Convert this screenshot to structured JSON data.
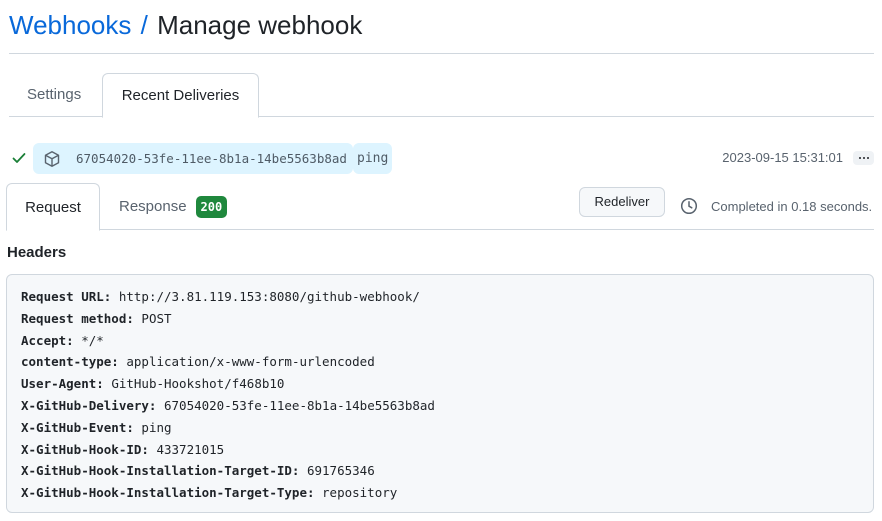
{
  "breadcrumb": {
    "parent": "Webhooks",
    "separator": "/",
    "current": "Manage webhook"
  },
  "tabs": {
    "settings": "Settings",
    "recent_deliveries": "Recent Deliveries"
  },
  "delivery": {
    "status_icon": "check-icon",
    "guid": "67054020-53fe-11ee-8b1a-14be5563b8ad",
    "event": "ping",
    "timestamp": "2023-09-15 15:31:01"
  },
  "subtabs": {
    "request": "Request",
    "response": "Response",
    "response_status": "200"
  },
  "redeliver_label": "Redeliver",
  "completed_text": "Completed in 0.18 seconds.",
  "headers_title": "Headers",
  "headers": [
    {
      "key": "Request URL:",
      "value": "http://3.81.119.153:8080/github-webhook/"
    },
    {
      "key": "Request method:",
      "value": "POST"
    },
    {
      "key": "Accept:",
      "value": "*/*"
    },
    {
      "key": "content-type:",
      "value": "application/x-www-form-urlencoded"
    },
    {
      "key": "User-Agent:",
      "value": "GitHub-Hookshot/f468b10"
    },
    {
      "key": "X-GitHub-Delivery:",
      "value": "67054020-53fe-11ee-8b1a-14be5563b8ad"
    },
    {
      "key": "X-GitHub-Event:",
      "value": "ping"
    },
    {
      "key": "X-GitHub-Hook-ID:",
      "value": "433721015"
    },
    {
      "key": "X-GitHub-Hook-Installation-Target-ID:",
      "value": "691765346"
    },
    {
      "key": "X-GitHub-Hook-Installation-Target-Type:",
      "value": "repository"
    }
  ],
  "colors": {
    "link": "#0969da",
    "success": "#1a7f37",
    "badge": "#1f883d",
    "chip_bg": "#ddf4ff"
  }
}
